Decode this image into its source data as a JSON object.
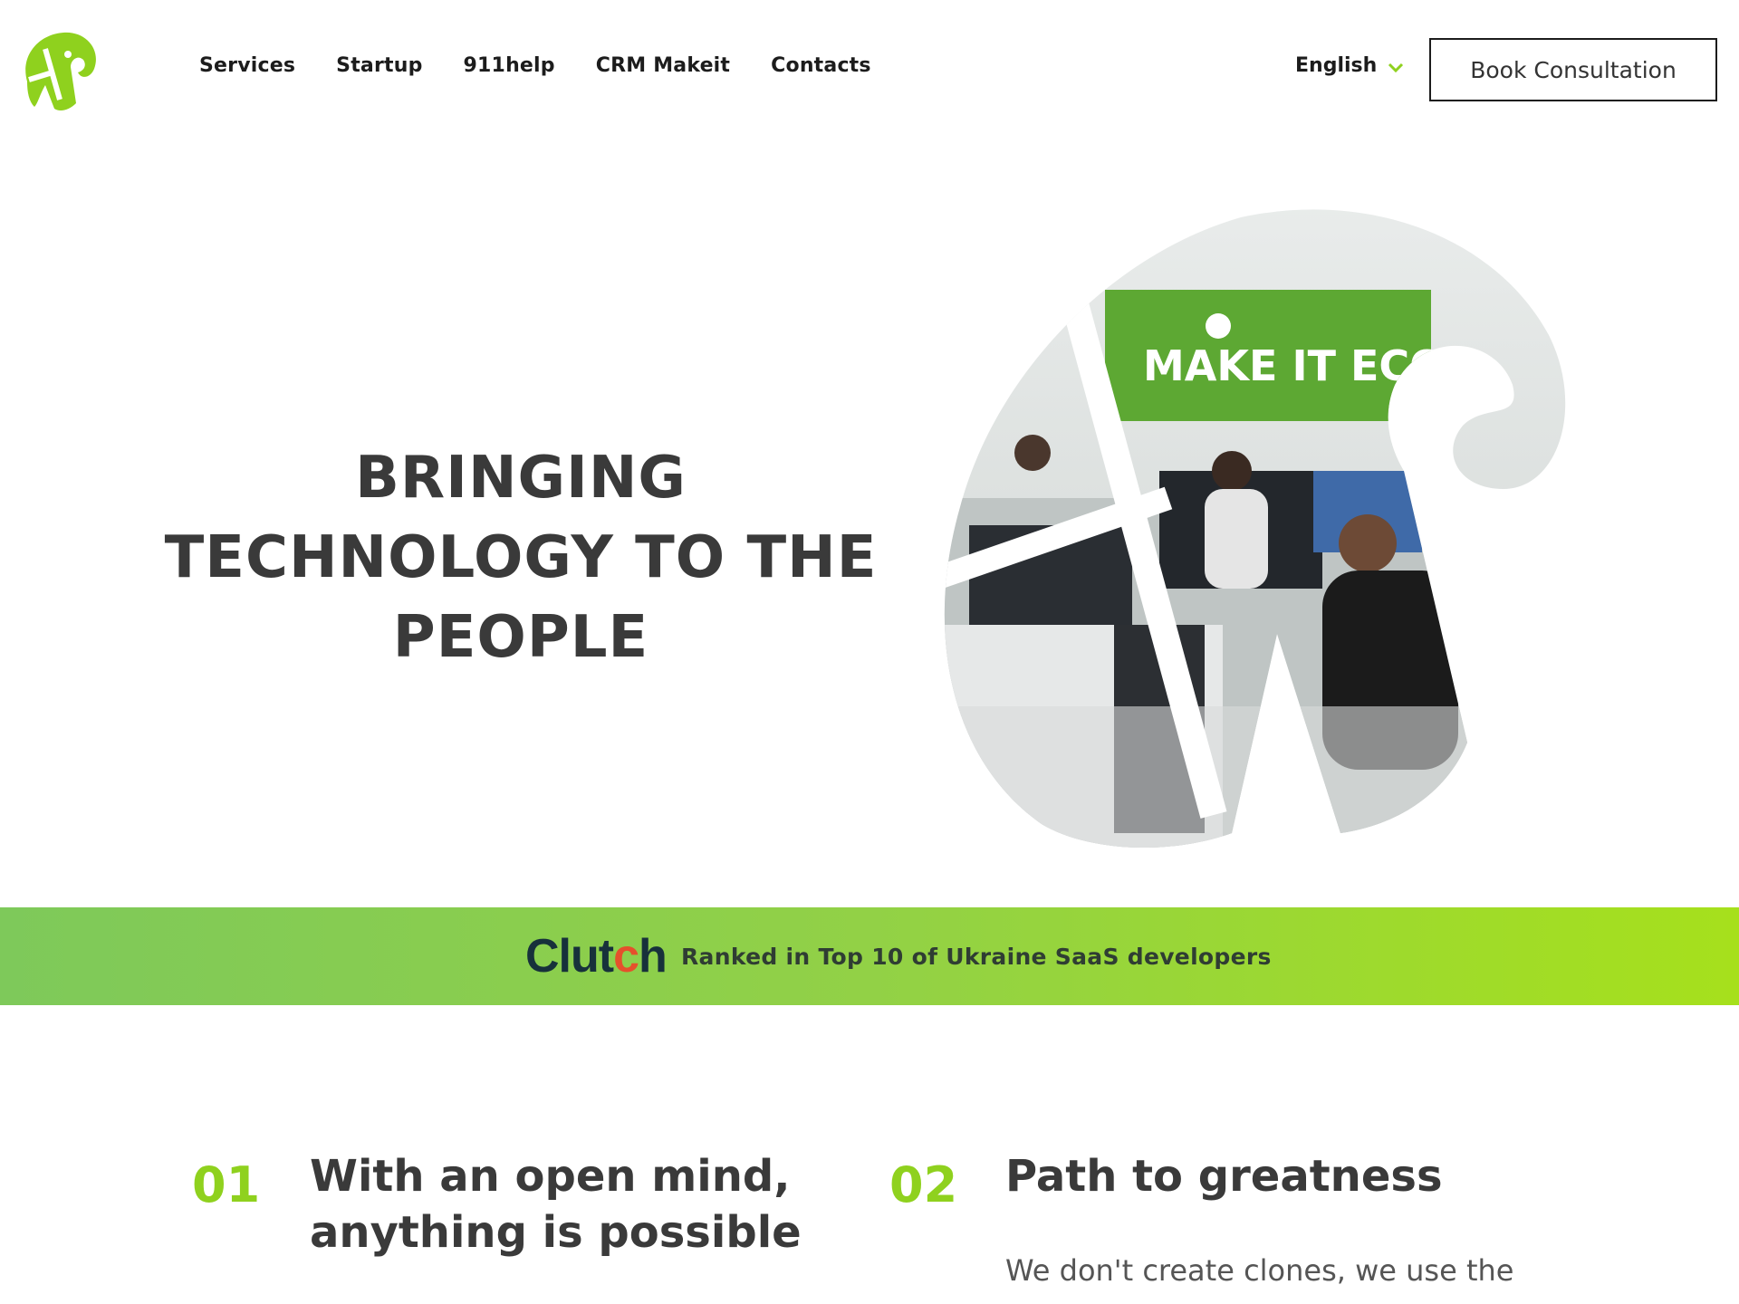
{
  "colors": {
    "brand_green": "#8fd11e",
    "text_dark": "#3a3a3a",
    "band_start": "#7ec95a",
    "band_end": "#a6e01c"
  },
  "header": {
    "logo_icon": "elephant-logo-icon",
    "nav": [
      "Services",
      "Startup",
      "911help",
      "CRM Makeit",
      "Contacts"
    ],
    "language": "English",
    "cta": "Book Consultation"
  },
  "hero": {
    "title_lines": [
      "BRINGING",
      "TECHNOLOGY TO THE",
      "PEOPLE"
    ],
    "image_sign_text": "MAKE IT ECO"
  },
  "clutch": {
    "logo_prefix": "Clut",
    "logo_dot": "c",
    "logo_suffix": "h",
    "text": "Ranked in Top 10 of Ukraine SaaS developers"
  },
  "features": [
    {
      "number": "01",
      "title_lines": [
        "With an open mind,",
        "anything is possible"
      ],
      "desc": ""
    },
    {
      "number": "02",
      "title_lines": [
        "Path to greatness"
      ],
      "desc": "We don't create clones, we use the"
    }
  ]
}
